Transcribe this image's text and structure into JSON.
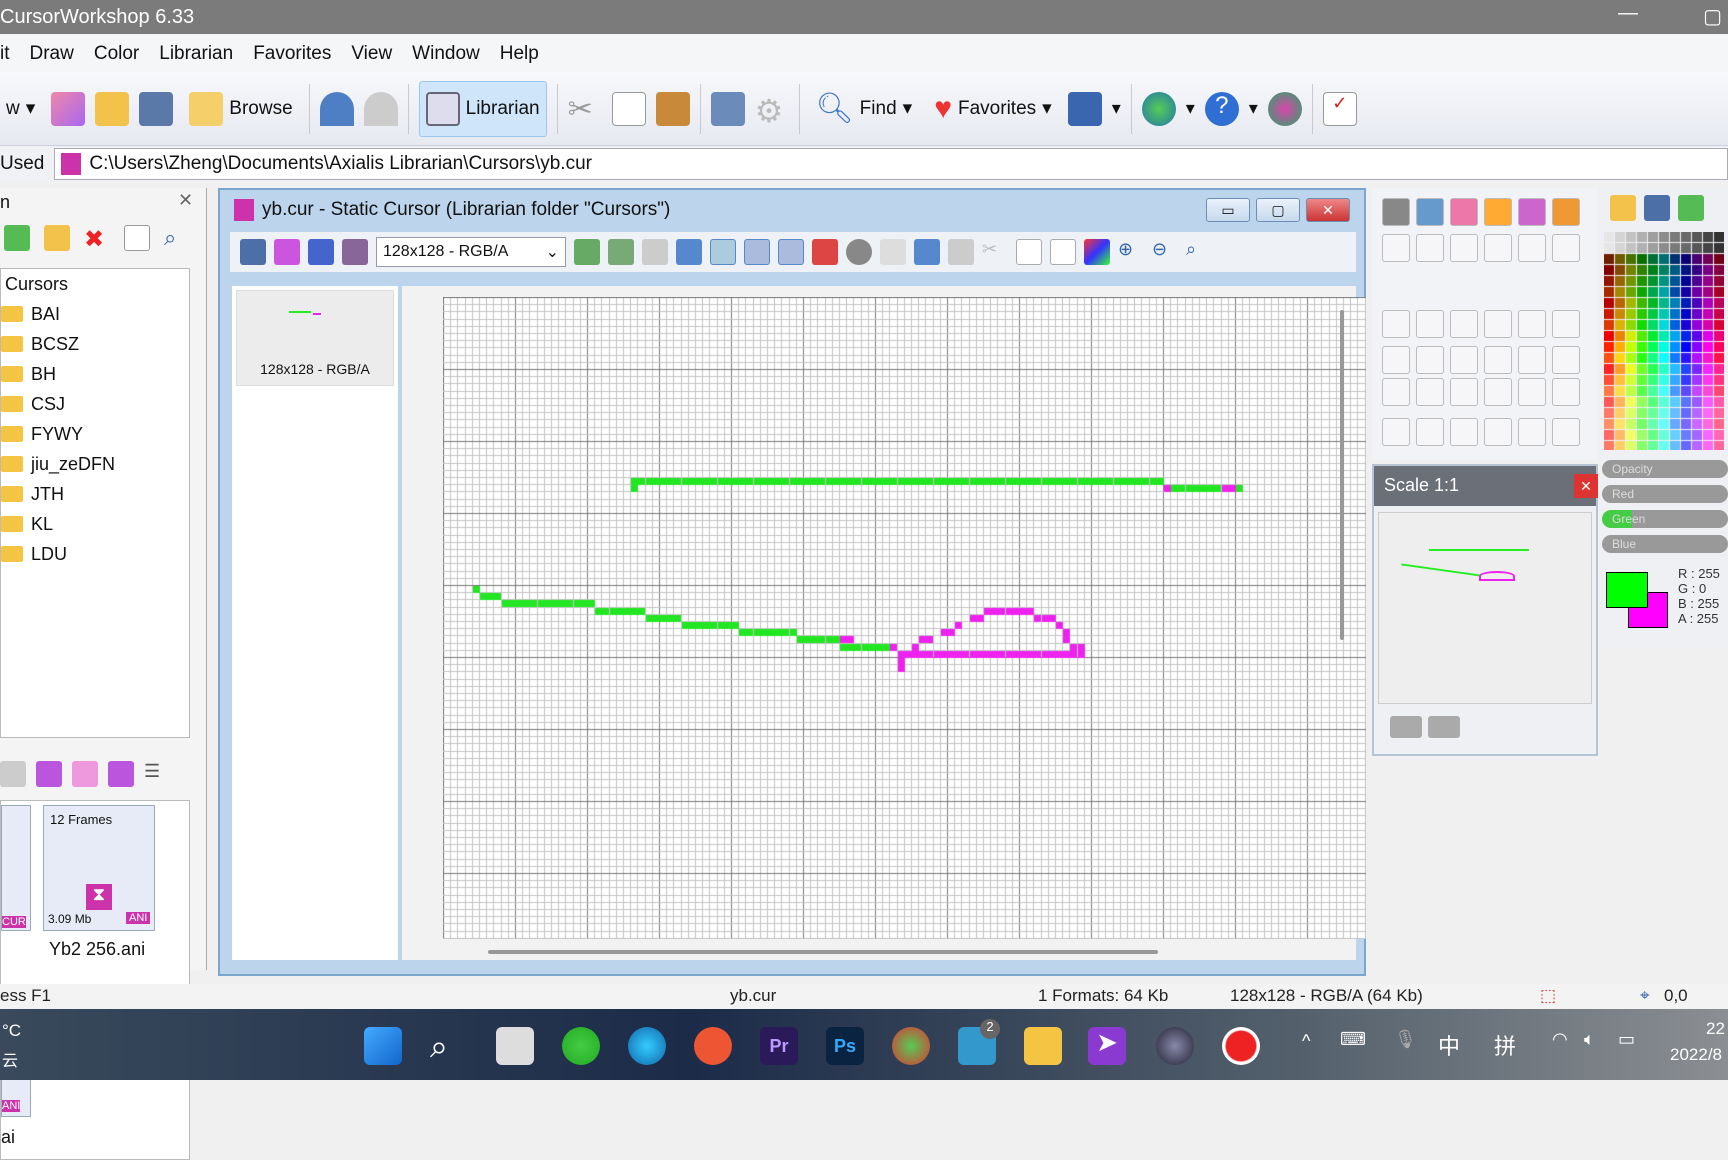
{
  "app": {
    "title": "CursorWorkshop 6.33"
  },
  "menu": [
    "it",
    "Draw",
    "Color",
    "Librarian",
    "Favorites",
    "View",
    "Window",
    "Help"
  ],
  "toolbar": {
    "new_label": "w",
    "browse_label": "Browse",
    "librarian_label": "Librarian",
    "find_label": "Find",
    "favorites_label": "Favorites"
  },
  "pathbar": {
    "label": "Used",
    "path": "C:\\Users\\Zheng\\Documents\\Axialis Librarian\\Cursors\\yb.cur"
  },
  "left_panel": {
    "title": "n",
    "tree_root": "Cursors",
    "folders": [
      "BAI",
      "BCSZ",
      "BH",
      "CSJ",
      "FYWY",
      "jiu_zeDFN",
      "JTH",
      "KL",
      "LDU"
    ],
    "files": [
      {
        "name": "Yb2 256.ani",
        "frames": "12 Frames",
        "size": "3.09 Mb",
        "type": "ANI"
      },
      {
        "name": "i",
        "type": "CUR"
      }
    ],
    "file3_type": "ANI",
    "file3_name": "ai"
  },
  "document": {
    "title": "yb.cur - Static Cursor (Librarian folder \"Cursors\")",
    "format_select": "128x128 - RGB/A",
    "thumbnail_label": "128x128 - RGB/A"
  },
  "scale_panel": {
    "title": "Scale 1:1"
  },
  "color_panel": {
    "sliders": [
      "Opacity",
      "Red",
      "Green",
      "Blue"
    ],
    "primary": "#00ff00",
    "secondary": "#ff00ff",
    "readout": [
      "R : 255",
      "G :   0",
      "B : 255",
      "A : 255"
    ]
  },
  "statusbar": {
    "help": "ess F1",
    "file": "yb.cur",
    "formats": "1 Formats: 64 Kb",
    "format_info": "128x128 - RGB/A (64 Kb)",
    "coords": "0,0"
  },
  "taskbar": {
    "weather": "°C",
    "weather2": "云",
    "mail_badge": "2",
    "ime1": "中",
    "ime2": "拼",
    "time": "22",
    "date": "2022/8"
  },
  "colors": {
    "green": "#22e622",
    "magenta": "#ee22ee",
    "title_bar": "#7b7b7b"
  }
}
